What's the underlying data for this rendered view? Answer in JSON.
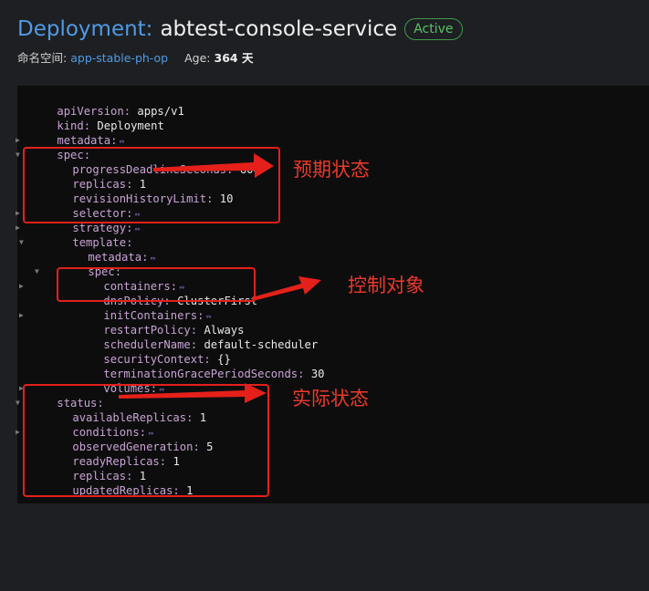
{
  "header": {
    "kind_label": "Deployment:",
    "name": "abtest-console-service",
    "status": "Active",
    "namespace_label": "命名空间:",
    "namespace": "app-stable-ph-op",
    "age_label": "Age:",
    "age_value": "364 天"
  },
  "yaml": {
    "apiVersion_key": "apiVersion",
    "apiVersion_val": "apps/v1",
    "kind_key": "kind",
    "kind_val": "Deployment",
    "metadata_key": "metadata",
    "spec_key": "spec",
    "progress_key": "progressDeadlineSeconds",
    "progress_val": "600",
    "replicas_key": "replicas",
    "replicas_val": "1",
    "revision_key": "revisionHistoryLimit",
    "revision_val": "10",
    "selector_key": "selector",
    "strategy_key": "strategy",
    "template_key": "template",
    "t_metadata_key": "metadata",
    "t_spec_key": "spec",
    "containers_key": "containers",
    "dnsPolicy_key": "dnsPolicy",
    "dnsPolicy_val": "ClusterFirst",
    "initContainers_key": "initContainers",
    "restartPolicy_key": "restartPolicy",
    "restartPolicy_val": "Always",
    "scheduler_key": "schedulerName",
    "scheduler_val": "default-scheduler",
    "security_key": "securityContext",
    "security_val": "{}",
    "termination_key": "terminationGracePeriodSeconds",
    "termination_val": "30",
    "volumes_key": "volumes",
    "status_key": "status",
    "available_key": "availableReplicas",
    "available_val": "1",
    "conditions_key": "conditions",
    "observed_key": "observedGeneration",
    "observed_val": "5",
    "ready_key": "readyReplicas",
    "ready_val": "1",
    "s_replicas_key": "replicas",
    "s_replicas_val": "1",
    "updated_key": "updatedReplicas",
    "updated_val": "1",
    "collapsed_glyph": "⇔"
  },
  "annotations": {
    "desired_state": "预期状态",
    "control_object": "控制对象",
    "actual_state": "实际状态"
  },
  "colors": {
    "accent_blue": "#4f9be6",
    "active_green": "#59c26a",
    "annotation_red": "#e5201a",
    "yaml_key": "#c9a3d4"
  },
  "icons": {
    "expand": "triangle-right-icon",
    "collapse": "triangle-down-icon",
    "collapsed_object": "double-arrow-icon"
  }
}
